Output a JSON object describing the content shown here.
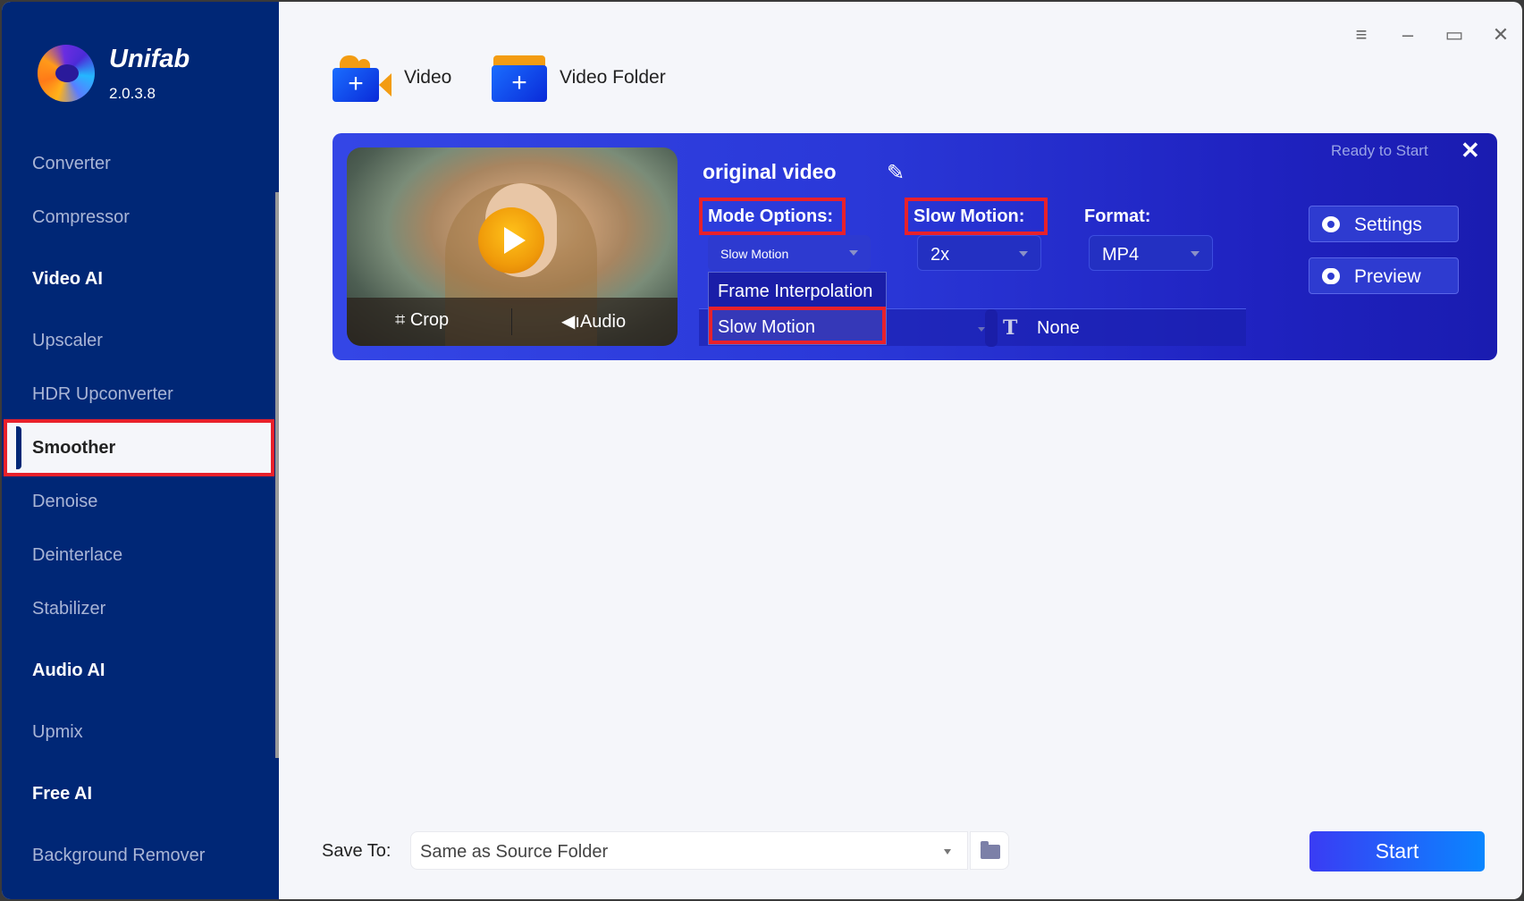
{
  "app": {
    "name": "Unifab",
    "version": "2.0.3.8"
  },
  "window_controls": {
    "menu": "≡",
    "minimize": "–",
    "maximize": "▭",
    "close": "✕"
  },
  "sidebar": {
    "items": [
      {
        "label": "Converter",
        "type": "item"
      },
      {
        "label": "Compressor",
        "type": "item"
      },
      {
        "label": "Video AI",
        "type": "header"
      },
      {
        "label": "Upscaler",
        "type": "item"
      },
      {
        "label": "HDR Upconverter",
        "type": "item"
      },
      {
        "label": "Smoother",
        "type": "item",
        "active": true
      },
      {
        "label": "Denoise",
        "type": "item"
      },
      {
        "label": "Deinterlace",
        "type": "item"
      },
      {
        "label": "Stabilizer",
        "type": "item"
      },
      {
        "label": "Audio AI",
        "type": "header"
      },
      {
        "label": "Upmix",
        "type": "item"
      },
      {
        "label": "Free AI",
        "type": "header"
      },
      {
        "label": "Background Remover",
        "type": "item"
      }
    ]
  },
  "toolbar": {
    "add_video": "Video",
    "add_folder": "Video Folder",
    "plus": "+"
  },
  "task": {
    "title": "original video",
    "status": "Ready to Start",
    "close": "✕",
    "thumb": {
      "crop": "Crop",
      "audio": "Audio",
      "crop_icon": "⌗",
      "audio_icon": "◀ı"
    },
    "mode_label": "Mode Options:",
    "mode_value": "Slow Motion",
    "mode_options": [
      "Frame Interpolation",
      "Slow Motion"
    ],
    "mode_highlighted": "Slow Motion",
    "slow_label": "Slow Motion:",
    "slow_value": "2x",
    "format_label": "Format:",
    "format_value": "MP4",
    "subtitle_icon": "T",
    "subtitle_value": "None",
    "settings": "Settings",
    "preview": "Preview",
    "edit_icon": "✎"
  },
  "footer": {
    "save_label": "Save To:",
    "save_value": "Same as Source Folder",
    "start": "Start"
  },
  "colors": {
    "sidebar": "#002776",
    "highlight": "#e8212b",
    "card": "#2a38d8",
    "start": "#1a66ff"
  }
}
